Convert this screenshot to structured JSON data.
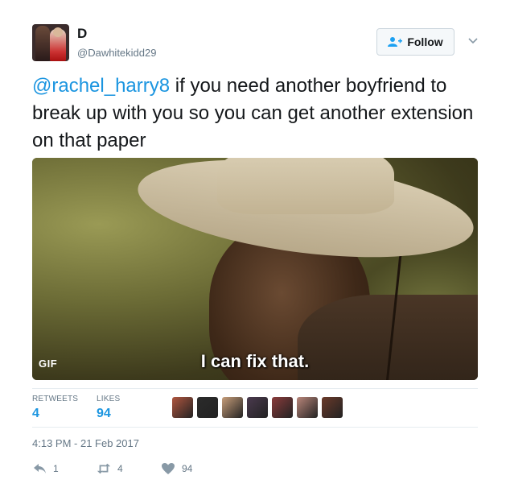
{
  "user": {
    "display_name": "D",
    "handle": "@Dawhitekidd29"
  },
  "follow_button": {
    "label": "Follow"
  },
  "tweet": {
    "mention": "@rachel_harry8",
    "text": " if you need another boyfriend to break up with you so you can get another extension on that paper"
  },
  "media": {
    "badge": "GIF",
    "caption": "I can fix that."
  },
  "stats": {
    "retweets_label": "RETWEETS",
    "retweets_value": "4",
    "likes_label": "LIKES",
    "likes_value": "94"
  },
  "likers": [
    {
      "color": "#b0563f"
    },
    {
      "color": "#2b2b2b"
    },
    {
      "color": "#c79e7a"
    },
    {
      "color": "#4a3a4e"
    },
    {
      "color": "#8a3b3b"
    },
    {
      "color": "#b9867a"
    },
    {
      "color": "#6a3a2a"
    }
  ],
  "timestamp": "4:13 PM - 21 Feb 2017",
  "actions": {
    "reply_count": "1",
    "retweet_count": "4",
    "like_count": "94"
  },
  "colors": {
    "link": "#1b95e0",
    "muted": "#657786",
    "text": "#14171a"
  }
}
